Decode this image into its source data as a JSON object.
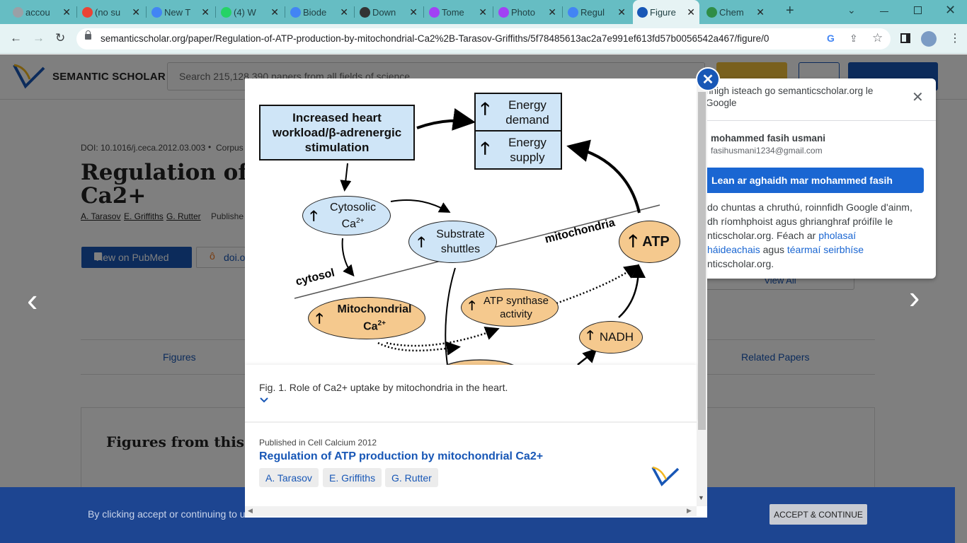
{
  "browser": {
    "tabs": [
      {
        "label": "accou",
        "icon": "google-account-icon"
      },
      {
        "label": "(no su",
        "icon": "gmail-icon"
      },
      {
        "label": "New T",
        "icon": "chrome-icon"
      },
      {
        "label": "(4) W",
        "icon": "whatsapp-icon"
      },
      {
        "label": "Biode",
        "icon": "google-icon"
      },
      {
        "label": "Down",
        "icon": "download-icon"
      },
      {
        "label": "Tome",
        "icon": "tome-icon"
      },
      {
        "label": "Photo",
        "icon": "photo-icon"
      },
      {
        "label": "Regul",
        "icon": "google-icon"
      },
      {
        "label": "Figure",
        "icon": "semantic-scholar-icon"
      },
      {
        "label": "Chem",
        "icon": "chem-icon"
      }
    ],
    "url": "semanticscholar.org/paper/Regulation-of-ATP-production-by-mitochondrial-Ca2%2B-Tarasov-Griffiths/5f78485613ac2a7e991ef613fd57b0056542a467/figure/0"
  },
  "header": {
    "logo_text": "SEMANTIC SCHOLAR",
    "search_placeholder": "Search 215,128,390 papers from all fields of science"
  },
  "paper": {
    "doi": "DOI: 10.1016/j.ceca.2012.03.003",
    "corpus": "Corpus",
    "title_line1": "Regulation of AT",
    "title_line2": "Ca2+",
    "authors": [
      "A. Tarasov",
      "E. Griffiths",
      "G. Rutter"
    ],
    "published": "Publishe",
    "pubmed_button": "View on PubMed",
    "doi_button": "doi.o",
    "view_all": "View All"
  },
  "tabs_bar": {
    "figures": "Figures",
    "related": "Related Papers"
  },
  "figures_heading": "Figures from this pap",
  "modal": {
    "figure": {
      "box1": "Increased heart workload/β-adrenergic stimulation",
      "energy_demand": "Energy demand",
      "energy_supply": "Energy supply",
      "cytosolic": "Cytosolic",
      "ca": "Ca",
      "sup": "2+",
      "substrate": "Substrate shuttles",
      "mitochondria_label": "mitochondria",
      "atp": "ATP",
      "cytosol_label": "cytosol",
      "mito_ca_line1": "Mitochondrial",
      "atp_synthase": "ATP synthase activity",
      "nadh": "NADH"
    },
    "caption": "Fig. 1. Role of Ca2+ uptake by mitochondria in the heart.",
    "published_in": "Published in Cell Calcium 2012",
    "paper_title": "Regulation of ATP production by mitochondrial Ca2+",
    "authors": [
      "A. Tarasov",
      "E. Griffiths",
      "G. Rutter"
    ]
  },
  "google_popup": {
    "title": "hnigh isteach go semanticscholar.org le Google",
    "name": "mohammed fasih usmani",
    "email": "fasihusmani1234@gmail.com",
    "continue_button": "Lean ar aghaidh mar mohammed fasih",
    "body1": "do chuntas a chruthú, roinnfidh Google d'ainm,",
    "body2": "dh ríomhphoist agus ghrianghraf próifíle le",
    "body3": "nticscholar.org. Féach ar",
    "link1": "pholasaí",
    "link2": "háideachais",
    "agus": "agus",
    "link3": "téarmaí seirbhíse",
    "body4": "nticscholar.org."
  },
  "cookie": {
    "text": "By clicking accept or continuing to u",
    "accept": "ACCEPT & CONTINUE"
  },
  "colors": {
    "tabstrip": "#66bdc3",
    "toolbar": "#e6f3f4",
    "brand_blue": "#1857b6",
    "cookie_bar": "#1d4591",
    "figure_blue": "#cfe5f7",
    "figure_orange": "#f5c98e"
  }
}
